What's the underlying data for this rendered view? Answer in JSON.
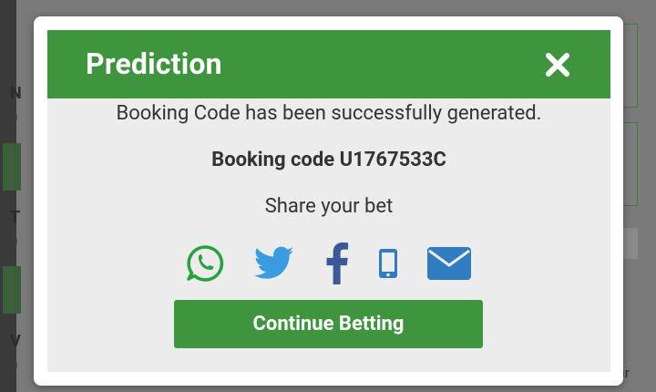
{
  "modal": {
    "title": "Prediction",
    "success_message": "Booking Code has been successfully generated.",
    "booking_code_text": "Booking code U1767533C",
    "share_label": "Share your bet",
    "continue_label": "Continue Betting",
    "share_icons": [
      "whatsapp-icon",
      "twitter-icon",
      "facebook-icon",
      "mobile-phone-icon",
      "email-icon"
    ]
  },
  "background": {
    "frag_1": "N",
    "frag_2": "0",
    "frag_3": "T",
    "frag_4": "0",
    "frag_5": "V",
    "frag_6": "0",
    "frag_7": "ır"
  },
  "colors": {
    "header_green": "#3e953e",
    "button_green": "#3e953e",
    "whatsapp": "#25a33a",
    "twitter": "#3a9be0",
    "facebook": "#3b5998",
    "phone": "#2f7cc0",
    "email": "#2f7cc0"
  }
}
